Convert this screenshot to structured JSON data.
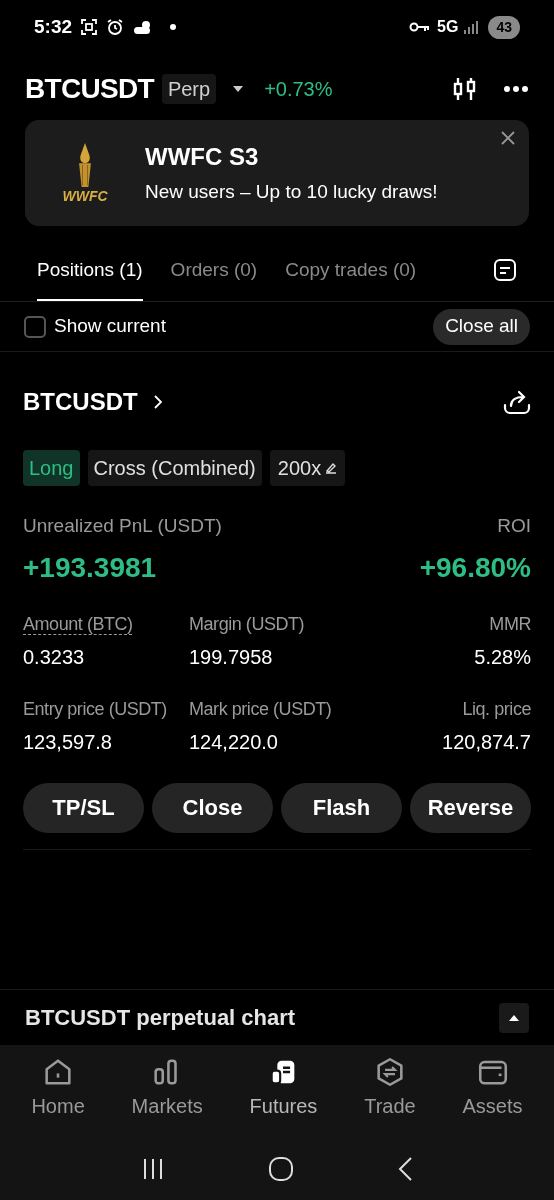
{
  "status_bar": {
    "time": "5:32",
    "network": "5G",
    "battery": "43"
  },
  "header": {
    "symbol": "BTCUSDT",
    "type_badge": "Perp",
    "change": "+0.73%"
  },
  "banner": {
    "logo_text": "WWFC",
    "title": "WWFC S3",
    "subtitle": "New users – Up to 10 lucky draws!"
  },
  "tabs": [
    {
      "label": "Positions (1)",
      "selected": true
    },
    {
      "label": "Orders (0)",
      "selected": false
    },
    {
      "label": "Copy trades (0)",
      "selected": false
    }
  ],
  "filter": {
    "label": "Show current",
    "checked": false,
    "close_all": "Close all"
  },
  "position": {
    "symbol": "BTCUSDT",
    "tags": [
      {
        "label": "Long",
        "kind": "side"
      },
      {
        "label": "Cross (Combined)",
        "kind": "plain"
      },
      {
        "label": "200x",
        "kind": "leverage"
      }
    ],
    "pnl_label": "Unrealized PnL (USDT)",
    "pnl": "+193.3981",
    "roi_label": "ROI",
    "roi": "+96.80%",
    "stats": [
      {
        "label": "Amount (BTC)",
        "value": "0.3233",
        "dotted": true
      },
      {
        "label": "Margin (USDT)",
        "value": "199.7958",
        "dotted": false
      },
      {
        "label": "MMR",
        "value": "5.28%",
        "dotted": false
      },
      {
        "label": "Entry price (USDT)",
        "value": "123,597.8",
        "dotted": false
      },
      {
        "label": "Mark price (USDT)",
        "value": "124,220.0",
        "dotted": false
      },
      {
        "label": "Liq. price",
        "value": "120,874.7",
        "dotted": false
      }
    ],
    "actions": [
      "TP/SL",
      "Close",
      "Flash",
      "Reverse"
    ]
  },
  "chart_bar": {
    "title": "BTCUSDT perpetual chart"
  },
  "bottom_nav": [
    {
      "label": "Home",
      "kind": "home",
      "selected": false
    },
    {
      "label": "Markets",
      "kind": "markets",
      "selected": false
    },
    {
      "label": "Futures",
      "kind": "futures",
      "selected": true
    },
    {
      "label": "Trade",
      "kind": "trade",
      "selected": false
    },
    {
      "label": "Assets",
      "kind": "assets",
      "selected": false
    }
  ]
}
